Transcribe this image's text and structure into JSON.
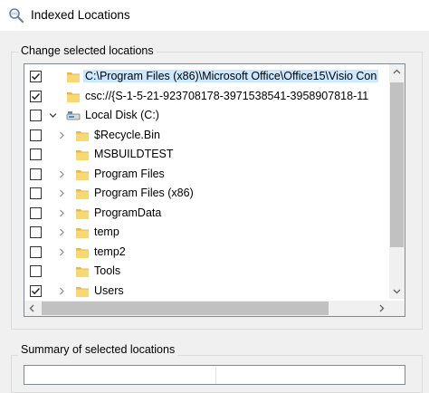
{
  "window": {
    "title": "Indexed Locations"
  },
  "change_group": {
    "label": "Change selected locations"
  },
  "tree": {
    "rows": [
      {
        "checked": true,
        "expander": "none",
        "icon": "folder-icon",
        "label": "C:\\Program Files (x86)\\Microsoft Office\\Office15\\Visio Con",
        "selected": true
      },
      {
        "checked": true,
        "expander": "none",
        "icon": "folder-icon",
        "label": "csc://{S-1-5-21-923708178-3971538541-3958907818-11"
      },
      {
        "checked": false,
        "expander": "expanded",
        "icon": "local-disk-icon",
        "label": "Local Disk (C:)"
      },
      {
        "checked": false,
        "expander": "collapsed",
        "icon": "folder-icon",
        "label": "$Recycle.Bin"
      },
      {
        "checked": false,
        "expander": "none",
        "icon": "folder-icon",
        "label": "MSBUILDTEST"
      },
      {
        "checked": false,
        "expander": "collapsed",
        "icon": "folder-icon",
        "label": "Program Files"
      },
      {
        "checked": false,
        "expander": "collapsed",
        "icon": "folder-icon",
        "label": "Program Files (x86)"
      },
      {
        "checked": false,
        "expander": "collapsed",
        "icon": "folder-icon",
        "label": "ProgramData"
      },
      {
        "checked": false,
        "expander": "collapsed",
        "icon": "folder-icon",
        "label": "temp"
      },
      {
        "checked": false,
        "expander": "collapsed",
        "icon": "folder-icon",
        "label": "temp2"
      },
      {
        "checked": false,
        "expander": "none",
        "icon": "folder-icon",
        "label": "Tools"
      },
      {
        "checked": true,
        "expander": "collapsed",
        "icon": "folder-icon",
        "label": "Users"
      }
    ]
  },
  "summary_group": {
    "label": "Summary of selected locations"
  },
  "colors": {
    "folder": "#f8d775",
    "folder_dark": "#e8b94a",
    "selection": "#cce8ff",
    "drive": "#4a90c8"
  }
}
